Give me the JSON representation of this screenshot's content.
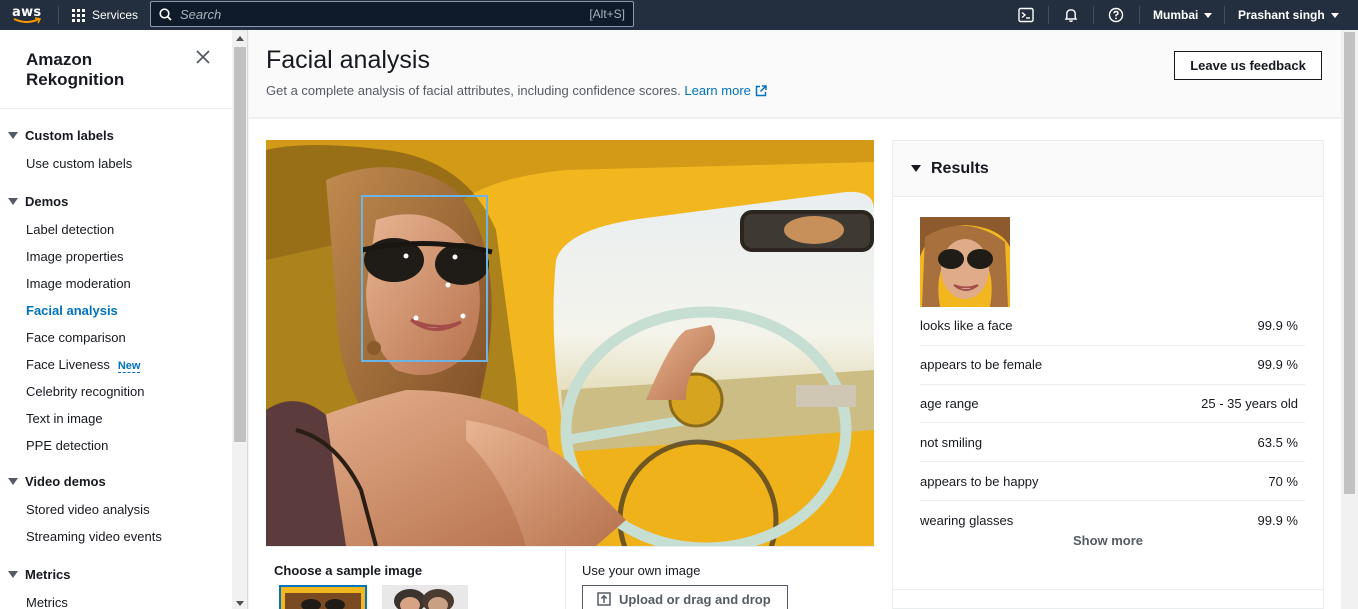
{
  "topbar": {
    "logo": "aws",
    "services_label": "Services",
    "search_placeholder": "Search",
    "search_shortcut": "[Alt+S]",
    "region": "Mumbai",
    "user": "Prashant singh",
    "icons": [
      "cloudshell-icon",
      "bell-icon",
      "help-icon"
    ]
  },
  "sidebar": {
    "title": "Amazon Rekognition",
    "groups": [
      {
        "label": "Custom labels",
        "items": [
          "Use custom labels"
        ]
      },
      {
        "label": "Demos",
        "items": [
          "Label detection",
          "Image properties",
          "Image moderation",
          "Facial analysis",
          "Face comparison",
          "Face Liveness",
          "Celebrity recognition",
          "Text in image",
          "PPE detection"
        ]
      },
      {
        "label": "Video demos",
        "items": [
          "Stored video analysis",
          "Streaming video events"
        ]
      },
      {
        "label": "Metrics",
        "items": [
          "Metrics"
        ]
      }
    ],
    "active_item": "Facial analysis",
    "new_badge": "New"
  },
  "header": {
    "title": "Facial analysis",
    "description": "Get a complete analysis of facial attributes, including confidence scores.",
    "learn_more": "Learn more",
    "feedback_button": "Leave us feedback"
  },
  "chooser": {
    "sample_title": "Choose a sample image",
    "own_title": "Use your own image",
    "upload_button": "Upload or drag and drop"
  },
  "results": {
    "title": "Results",
    "rows": [
      {
        "label": "looks like a face",
        "value": "99.9 %"
      },
      {
        "label": "appears to be female",
        "value": "99.9 %"
      },
      {
        "label": "age range",
        "value": "25 - 35 years old"
      },
      {
        "label": "not smiling",
        "value": "63.5 %"
      },
      {
        "label": "appears to be happy",
        "value": "70 %"
      },
      {
        "label": "wearing glasses",
        "value": "99.9 %"
      }
    ],
    "show_more": "Show more"
  },
  "colors": {
    "topbar": "#232f3e",
    "link": "#0073bb",
    "bounding_box": "#6cb4e4",
    "car_yellow": "#f2b71f"
  }
}
